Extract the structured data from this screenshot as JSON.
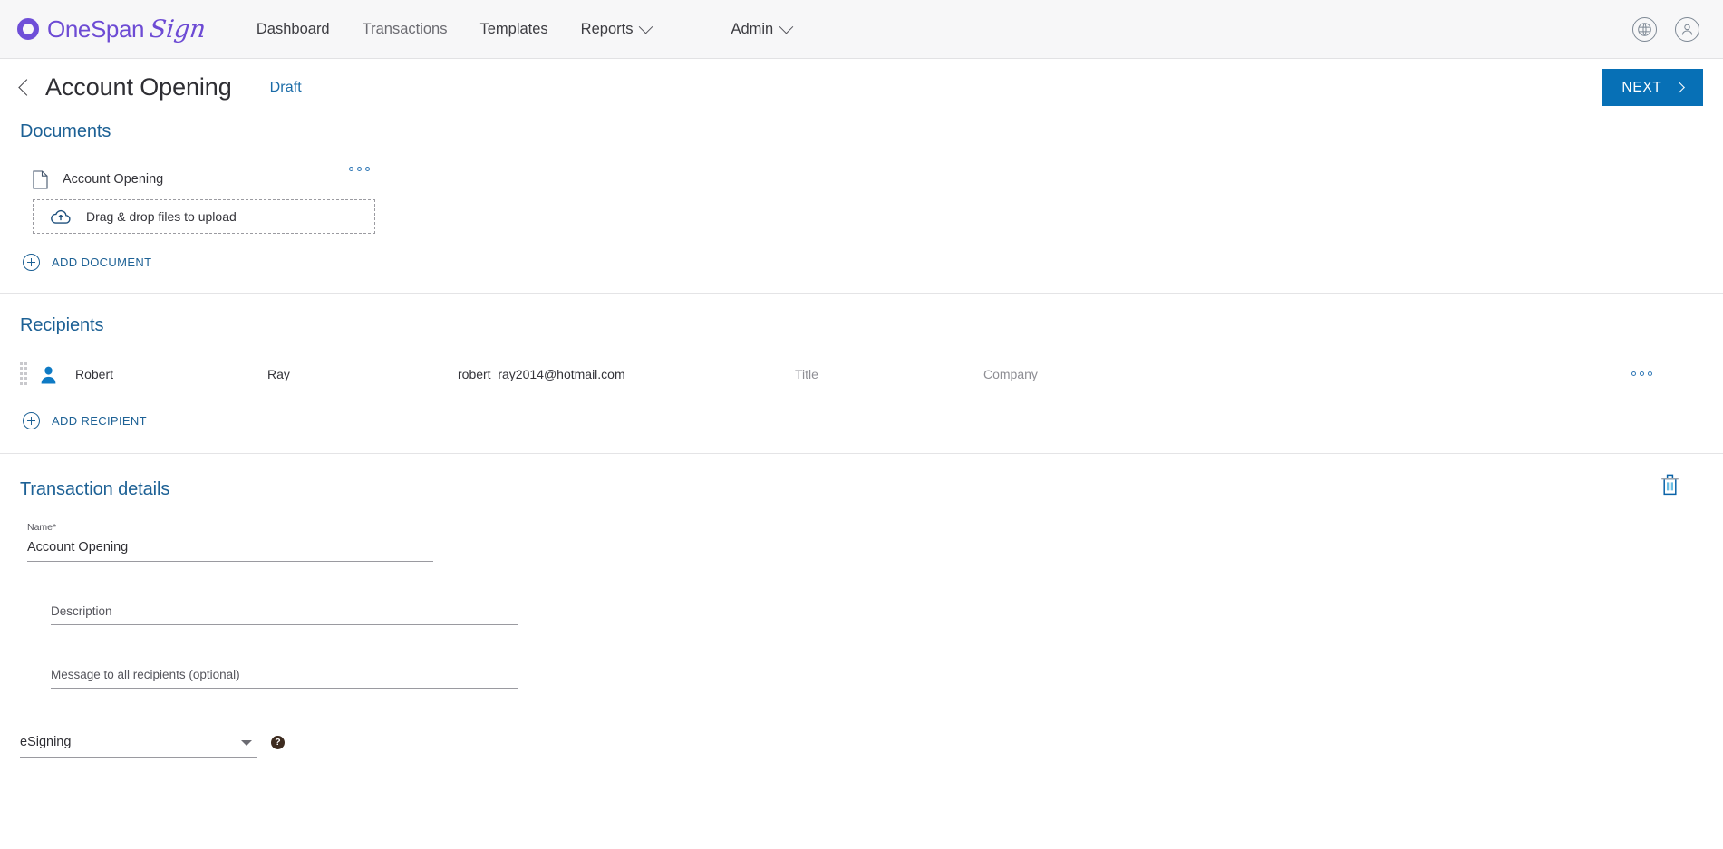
{
  "navbar": {
    "brand": {
      "word": "OneSpan",
      "script": "Sign"
    },
    "links": [
      {
        "label": "Dashboard",
        "active": true,
        "has_caret": false
      },
      {
        "label": "Transactions",
        "active": false,
        "has_caret": false
      },
      {
        "label": "Templates",
        "active": false,
        "has_caret": false
      },
      {
        "label": "Reports",
        "active": false,
        "has_caret": true
      },
      {
        "label": "Admin",
        "active": false,
        "has_caret": true
      }
    ],
    "right_icons": [
      {
        "name": "globe-language-icon"
      },
      {
        "name": "user-account-icon"
      }
    ]
  },
  "titlebar": {
    "back_label": "back",
    "title": "Account Opening",
    "status": "Draft",
    "next_label": "NEXT"
  },
  "documents": {
    "heading": "Documents",
    "items": [
      {
        "name": "Account Opening"
      }
    ],
    "dropzone_label": "Drag & drop files to upload",
    "add_label": "ADD DOCUMENT"
  },
  "recipients": {
    "heading": "Recipients",
    "rows": [
      {
        "first_name": "Robert",
        "last_name": "Ray",
        "email": "robert_ray2014@hotmail.com",
        "title_placeholder": "Title",
        "company_placeholder": "Company"
      }
    ],
    "add_label": "ADD RECIPIENT"
  },
  "transaction_details": {
    "heading": "Transaction details",
    "name_label": "Name",
    "name_required_mark": "*",
    "name_value": "Account Opening",
    "description_placeholder": "Description",
    "description_value": "",
    "message_placeholder": "Message to all recipients (optional)",
    "message_value": "",
    "type_value": "eSigning",
    "help_glyph": "?"
  },
  "colors": {
    "brand_purple": "#6d4bd4",
    "accent_blue": "#0770b6",
    "section_heading_blue": "#1d6195",
    "link_blue": "#1d6195",
    "navbar_bg": "#f7f7f8",
    "divider": "#e4e4e6",
    "placeholder_gray": "#8e8e94"
  }
}
